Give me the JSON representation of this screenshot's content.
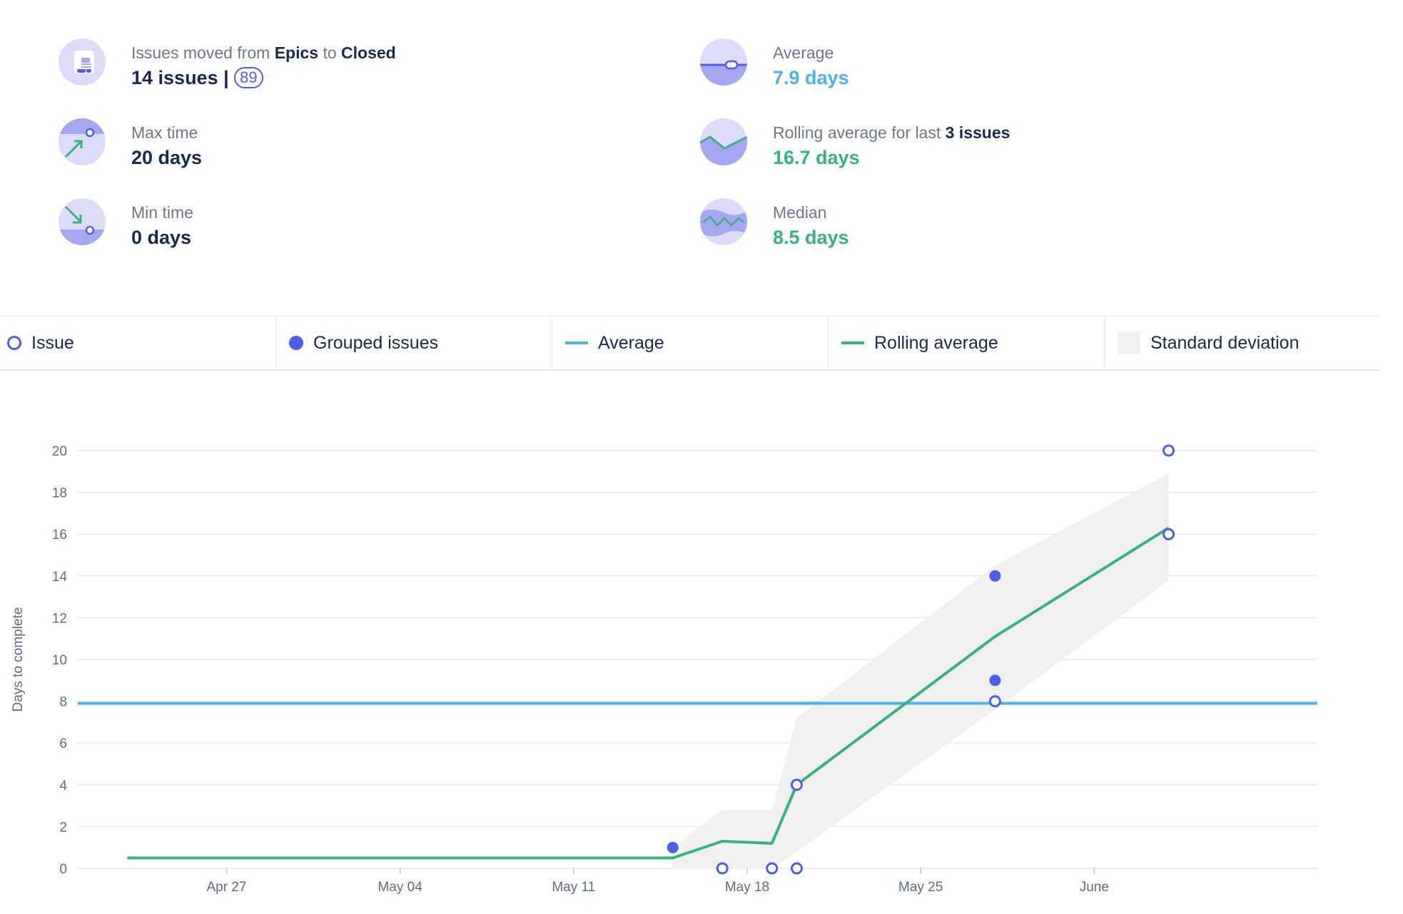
{
  "summary": {
    "moved_prefix": "Issues moved from",
    "moved_from": "Epics",
    "moved_to_word": "to",
    "moved_to": "Closed",
    "issues_count": "14 issues |",
    "issues_badge": "89",
    "max_label": "Max time",
    "max_value": "20 days",
    "min_label": "Min time",
    "min_value": "0 days",
    "avg_label": "Average",
    "avg_value": "7.9 days",
    "rolling_prefix": "Rolling average for last",
    "rolling_count": "3 issues",
    "rolling_value": "16.7 days",
    "median_label": "Median",
    "median_value": "8.5 days"
  },
  "legend": {
    "issue": "Issue",
    "grouped": "Grouped issues",
    "average": "Average",
    "rolling": "Rolling average",
    "stddev": "Standard deviation"
  },
  "colors": {
    "issue": "#4c5fea",
    "average": "#4bb3e8",
    "rolling": "#36b37e",
    "stddev": "#f0f0f0",
    "icon_light": "#dcdcf8",
    "icon_dark": "#a5a7f3"
  },
  "chart_data": {
    "type": "scatter",
    "ylabel": "Days to complete",
    "xlabel": "",
    "ylim": [
      0,
      20
    ],
    "yticks": [
      0,
      2,
      4,
      6,
      8,
      10,
      12,
      14,
      16,
      18,
      20
    ],
    "xlim": [
      "2026-04-21",
      "2026-06-10"
    ],
    "xticks": [
      {
        "label": "Apr 27",
        "date": "2026-04-27"
      },
      {
        "label": "May 04",
        "date": "2026-05-04"
      },
      {
        "label": "May 11",
        "date": "2026-05-11"
      },
      {
        "label": "May 18",
        "date": "2026-05-18"
      },
      {
        "label": "May 25",
        "date": "2026-05-25"
      },
      {
        "label": "June",
        "date": "2026-06-01"
      }
    ],
    "issues": [
      {
        "date": "2026-05-17",
        "y": 0
      },
      {
        "date": "2026-05-19",
        "y": 0
      },
      {
        "date": "2026-05-20",
        "y": 0
      },
      {
        "date": "2026-05-20",
        "y": 4
      },
      {
        "date": "2026-05-28",
        "y": 8
      },
      {
        "date": "2026-06-04",
        "y": 16
      },
      {
        "date": "2026-06-04",
        "y": 20
      }
    ],
    "grouped_issues": [
      {
        "date": "2026-05-15",
        "y": 1
      },
      {
        "date": "2026-05-28",
        "y": 9
      },
      {
        "date": "2026-05-28",
        "y": 14
      }
    ],
    "average": 7.9,
    "rolling_average": [
      {
        "date": "2026-04-23",
        "y": 0.5
      },
      {
        "date": "2026-05-15",
        "y": 0.5
      },
      {
        "date": "2026-05-17",
        "y": 1.3
      },
      {
        "date": "2026-05-19",
        "y": 1.2
      },
      {
        "date": "2026-05-20",
        "y": 4
      },
      {
        "date": "2026-05-28",
        "y": 11.1
      },
      {
        "date": "2026-06-04",
        "y": 16.3
      }
    ],
    "std_upper": [
      {
        "date": "2026-05-15",
        "y": 1
      },
      {
        "date": "2026-05-17",
        "y": 2.8
      },
      {
        "date": "2026-05-19",
        "y": 2.8
      },
      {
        "date": "2026-05-20",
        "y": 7.2
      },
      {
        "date": "2026-05-28",
        "y": 14.5
      },
      {
        "date": "2026-06-04",
        "y": 18.9
      }
    ],
    "std_lower": [
      {
        "date": "2026-06-04",
        "y": 13.8
      },
      {
        "date": "2026-05-28",
        "y": 7.6
      },
      {
        "date": "2026-05-20",
        "y": 0.8
      },
      {
        "date": "2026-05-19",
        "y": 0
      },
      {
        "date": "2026-05-15",
        "y": 0
      }
    ]
  }
}
